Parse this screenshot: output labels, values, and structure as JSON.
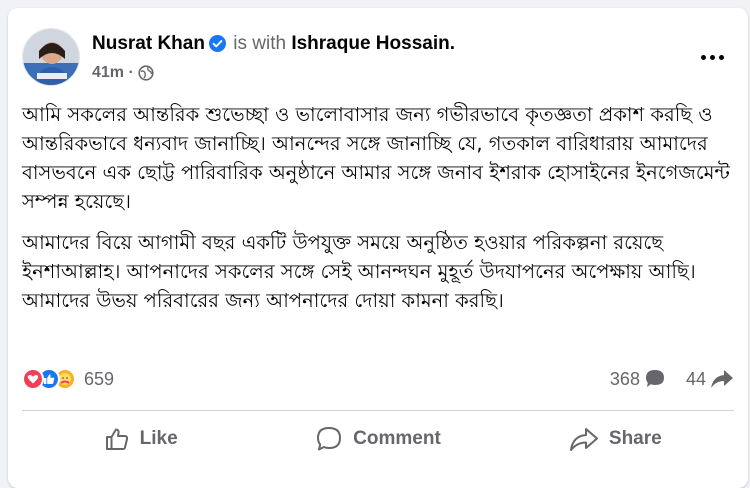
{
  "post": {
    "author": "Nusrat Khan",
    "with_text": "is with",
    "tagged": "Ishraque Hossain.",
    "time": "41m ·",
    "paragraphs": [
      "আমি সকলের আন্তরিক শুভেচ্ছা ও ভালোবাসার জন্য গভীরভাবে কৃতজ্ঞতা প্রকাশ করছি ও আন্তরিকভাবে ধন্যবাদ জানাচ্ছি। আনন্দের সঙ্গে জানাচ্ছি যে, গতকাল বারিধারায় আমাদের বাসভবনে এক ছোট্ট পারিবারিক অনুষ্ঠানে আমার সঙ্গে জনাব ইশরাক হোসাইনের ইনগেজমেন্ট সম্পন্ন হয়েছে।",
      "আমাদের বিয়ে আগামী বছর একটি উপযুক্ত সময়ে অনুষ্ঠিত হওয়ার পরিকল্পনা রয়েছে ইনশাআল্লাহ। আপনাদের সকলের সঙ্গে সেই আনন্দঘন মুহূর্ত উদযাপনের অপেক্ষায় আছি। আমাদের উভয় পরিবারের জন্য আপনাদের দোয়া কামনা করছি।"
    ]
  },
  "stats": {
    "reactions_count": "659",
    "comments_count": "368",
    "shares_count": "44"
  },
  "actions": {
    "like": "Like",
    "comment": "Comment",
    "share": "Share"
  },
  "colors": {
    "brand": "#1877f2",
    "love": "#f33e58",
    "care": "#f7b125",
    "secondary_text": "#65676b"
  }
}
